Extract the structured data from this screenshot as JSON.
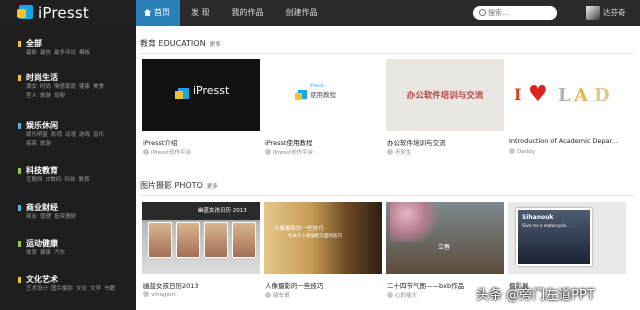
{
  "brand": {
    "name": "iPresst"
  },
  "nav": [
    "首页",
    "发 现",
    "我的作品",
    "创建作品"
  ],
  "search": {
    "placeholder": "搜索..."
  },
  "user": {
    "name": "达芬奇"
  },
  "sidebar": [
    {
      "title": "全部",
      "color": "#f2c230",
      "subs": [
        "最新",
        "最热",
        "最多评论",
        "模板"
      ]
    },
    {
      "title": "时尚生活",
      "color": "#f2c230",
      "subs": [
        "潮女",
        "时尚",
        "情感家庭",
        "健康",
        "美食",
        "型人",
        "旅游",
        "母婴"
      ]
    },
    {
      "title": "娱乐休闲",
      "color": "#5bb0e0",
      "subs": [
        "娱乐明星",
        "影视",
        "动漫",
        "游戏",
        "音乐",
        "搞笑",
        "旅游"
      ]
    },
    {
      "title": "科技教育",
      "color": "#8dc63f",
      "subs": [
        "互联网",
        "IT数码",
        "科技",
        "教育"
      ]
    },
    {
      "title": "商业财经",
      "color": "#5bb0e0",
      "subs": [
        "商业",
        "管理",
        "投资理财"
      ]
    },
    {
      "title": "运动健康",
      "color": "#8dc63f",
      "subs": [
        "体育",
        "健康",
        "汽车"
      ]
    },
    {
      "title": "文化艺术",
      "color": "#f2c230",
      "subs": [
        "艺术设计",
        "图片摄影",
        "文化",
        "文学",
        "书籍"
      ]
    }
  ],
  "sections": [
    {
      "title": "教育 EDUCATION",
      "more": "更多",
      "cards": [
        {
          "title": "iPresst介绍",
          "author": "iPresst创作平台",
          "thumb_text": "iPresst"
        },
        {
          "title": "iPresst使用教程",
          "author": "iPresst创作平台",
          "thumb_text": "使用教程",
          "thumb_sub": "iPresst"
        },
        {
          "title": "办公软件培训与交流",
          "author": "不安生",
          "thumb_text": "办公软件培训与交流"
        },
        {
          "title": "Introduction of Academic Depar...",
          "author": "Daddy",
          "thumb_text": "I LOAD"
        }
      ]
    },
    {
      "title": "图片摄影 PHOTO",
      "more": "更多",
      "cards": [
        {
          "title": "幽蓝女孩日历2013",
          "author": "vmagent",
          "thumb_text": "幽蓝女孩日历 2013"
        },
        {
          "title": "人像摄影的一些技巧",
          "author": "骑车哥",
          "thumb_text": "人像摄影的一些技巧",
          "thumb_sub": "有关于人像摄影方面的技巧"
        },
        {
          "title": "二十四节气图——bxb作品",
          "author": "心的插大",
          "thumb_text": "立春"
        },
        {
          "title": "摄影展",
          "author": "",
          "thumb_text": "Sihanouk",
          "thumb_sub": "Give me a motorcycle..."
        }
      ]
    }
  ],
  "watermark": "头条 @旁门左道PPT"
}
